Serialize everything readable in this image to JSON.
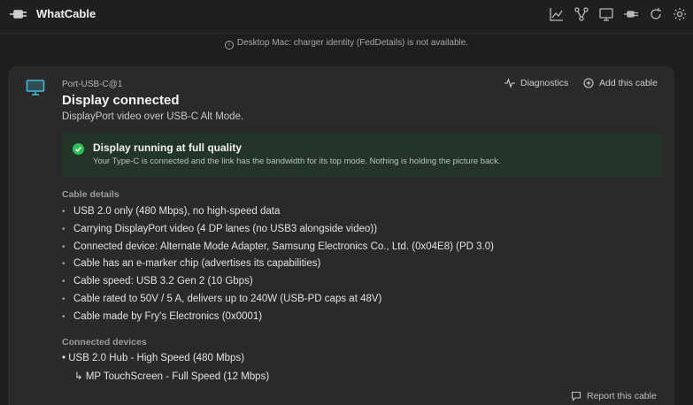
{
  "app": {
    "title": "WhatCable",
    "icon": "usb-plug-icon",
    "toolbar_icons": [
      "chart-icon",
      "network-icon",
      "monitor-icon",
      "plug-icon",
      "refresh-icon",
      "gear-icon"
    ]
  },
  "notice": {
    "icon": "info-icon",
    "text": "Desktop Mac: charger identity (FedDetails) is not available."
  },
  "card": {
    "port": "Port-USB-C@1",
    "title": "Display connected",
    "subtitle": "DisplayPort video over USB-C Alt Mode.",
    "actions": {
      "diagnostics": "Diagnostics",
      "add_cable": "Add this cable"
    },
    "banner": {
      "title": "Display running at full quality",
      "body": "Your Type-C is connected and the link has the bandwidth for its top mode. Nothing is holding the picture back.",
      "color": "#2fbf5a"
    },
    "cable_details": {
      "heading": "Cable details",
      "items": [
        "USB 2.0 only (480 Mbps), no high-speed data",
        "Carrying DisplayPort video (4 DP lanes (no USB3 alongside video))",
        "Connected device: Alternate Mode Adapter, Samsung Electronics Co., Ltd. (0x04E8) (PD 3.0)",
        "Cable has an e-marker chip (advertises its capabilities)",
        "Cable speed: USB 3.2 Gen 2 (10 Gbps)",
        "Cable rated to 50V / 5 A, delivers up to 240W (USB-PD caps at 48V)",
        "Cable made by Fry's Electronics (0x0001)"
      ]
    },
    "connected_devices": {
      "heading": "Connected devices",
      "items": [
        "• USB 2.0 Hub - High Speed (480 Mbps)",
        "↳ MP TouchScreen - Full Speed (12 Mbps)"
      ]
    },
    "report": "Report this cable"
  },
  "colors": {
    "accent": "#46b6d6",
    "success": "#2fbf5a",
    "banner_bg": "#233429"
  }
}
